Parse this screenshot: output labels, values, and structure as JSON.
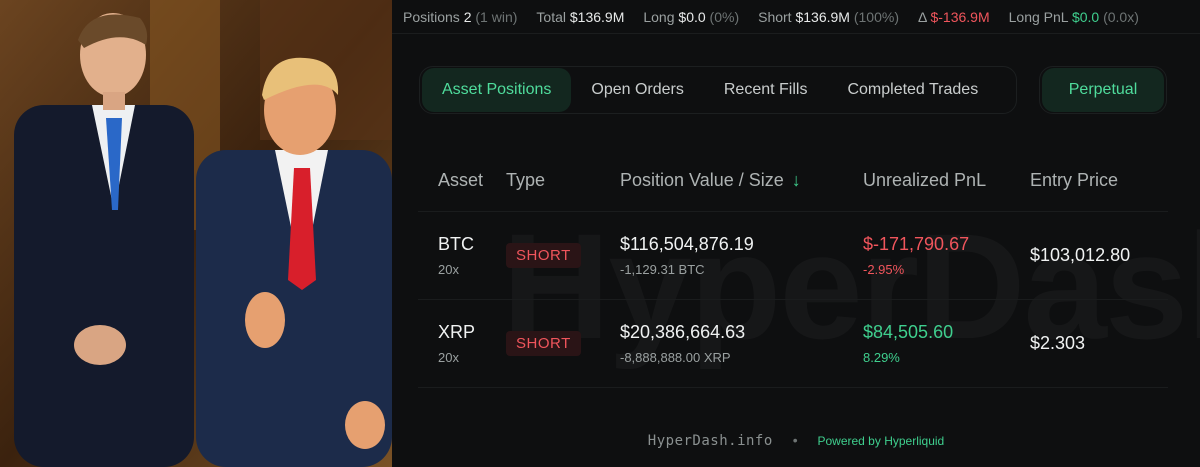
{
  "stats": {
    "positions_label": "Positions",
    "positions_value": "2",
    "positions_sub": "(1 win)",
    "total_label": "Total",
    "total_value": "$136.9M",
    "long_label": "Long",
    "long_value": "$0.0",
    "long_pct": "(0%)",
    "short_label": "Short",
    "short_value": "$136.9M",
    "short_pct": "(100%)",
    "delta_label": "Δ",
    "delta_value": "$-136.9M",
    "longpnl_label": "Long PnL",
    "longpnl_value": "$0.0",
    "longpnl_sub": "(0.0x)"
  },
  "tabs": {
    "asset_positions": "Asset Positions",
    "open_orders": "Open Orders",
    "recent_fills": "Recent Fills",
    "completed_trades": "Completed Trades",
    "perpetual": "Perpetual"
  },
  "table": {
    "headers": {
      "asset": "Asset",
      "type": "Type",
      "position_value": "Position Value / Size",
      "sort_icon": "↓",
      "unrealized_pnl": "Unrealized PnL",
      "entry_price": "Entry Price"
    },
    "rows": [
      {
        "asset": "BTC",
        "leverage": "20x",
        "type": "SHORT",
        "value": "$116,504,876.19",
        "size": "-1,129.31 BTC",
        "pnl": "$-171,790.67",
        "pnl_pct": "-2.95%",
        "entry": "$103,012.80"
      },
      {
        "asset": "XRP",
        "leverage": "20x",
        "type": "SHORT",
        "value": "$20,386,664.63",
        "size": "-8,888,888.00 XRP",
        "pnl": "$84,505.60",
        "pnl_pct": "8.29%",
        "entry": "$2.303"
      }
    ]
  },
  "watermark": "HyperDash",
  "footer": {
    "brand": "HyperDash.info",
    "separator": "•",
    "powered": "Powered by Hyperliquid"
  },
  "colors": {
    "accent_green": "#3fcf8e",
    "negative_red": "#f0555c",
    "background": "#0e0f10"
  }
}
